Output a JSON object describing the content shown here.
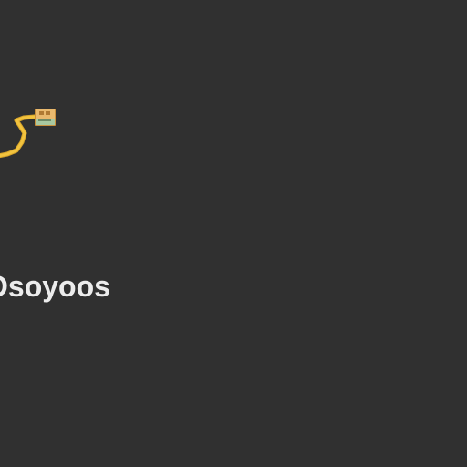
{
  "map": {
    "background_color": "#303030",
    "road_color": "#f2c33e",
    "road_casing_color": "#d9a62a"
  },
  "labels": {
    "place": "Osoyoos"
  },
  "shield": {
    "icon": "highway-shield-icon",
    "colors": {
      "top": "#e9b96e",
      "bottom": "#a8c8a0",
      "border": "#c9903c"
    }
  }
}
